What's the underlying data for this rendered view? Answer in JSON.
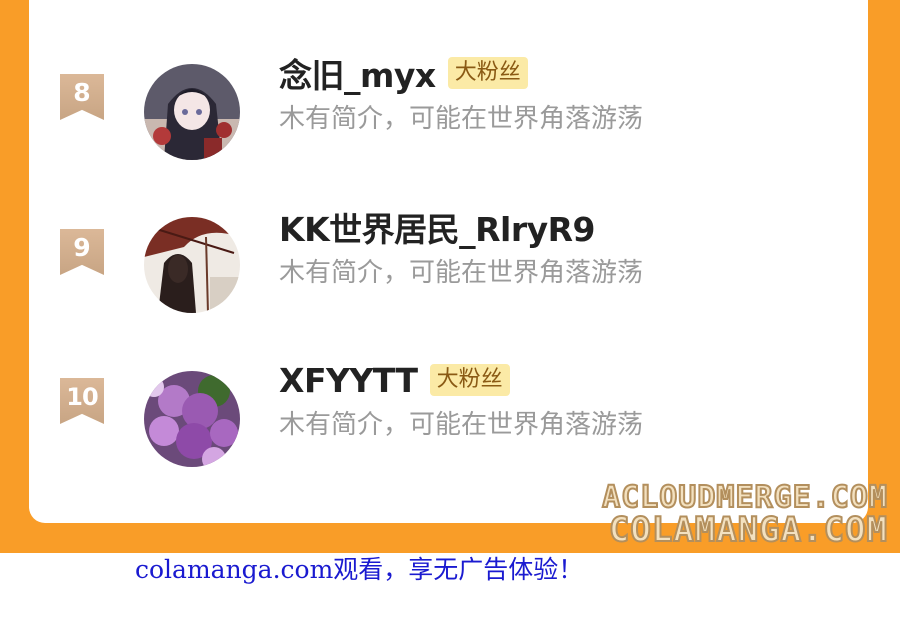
{
  "ranking": [
    {
      "rank": "8",
      "name": "念旧_myx",
      "badge": "大粉丝",
      "bio": "木有简介，可能在世界角落游荡",
      "avatar": "anime-girl-avatar"
    },
    {
      "rank": "9",
      "name": "KK世界居民_RlryR9",
      "badge": "",
      "bio": "木有简介，可能在世界角落游荡",
      "avatar": "umbrella-figure-avatar"
    },
    {
      "rank": "10",
      "name": "XFYYTT",
      "badge": "大粉丝",
      "bio": "木有简介，可能在世界角落游荡",
      "avatar": "lilac-flowers-avatar"
    }
  ],
  "watermark": {
    "line1": "ACLOUDMERGE.COM",
    "line2": "COLAMANGA.COM"
  },
  "footer": {
    "text": "colamanga.com观看，享无广告体验！"
  },
  "colors": {
    "frame": "#f99d28",
    "badge": "#fbeaa6",
    "rank": "#cfac8b",
    "link": "#1a1ad0"
  }
}
